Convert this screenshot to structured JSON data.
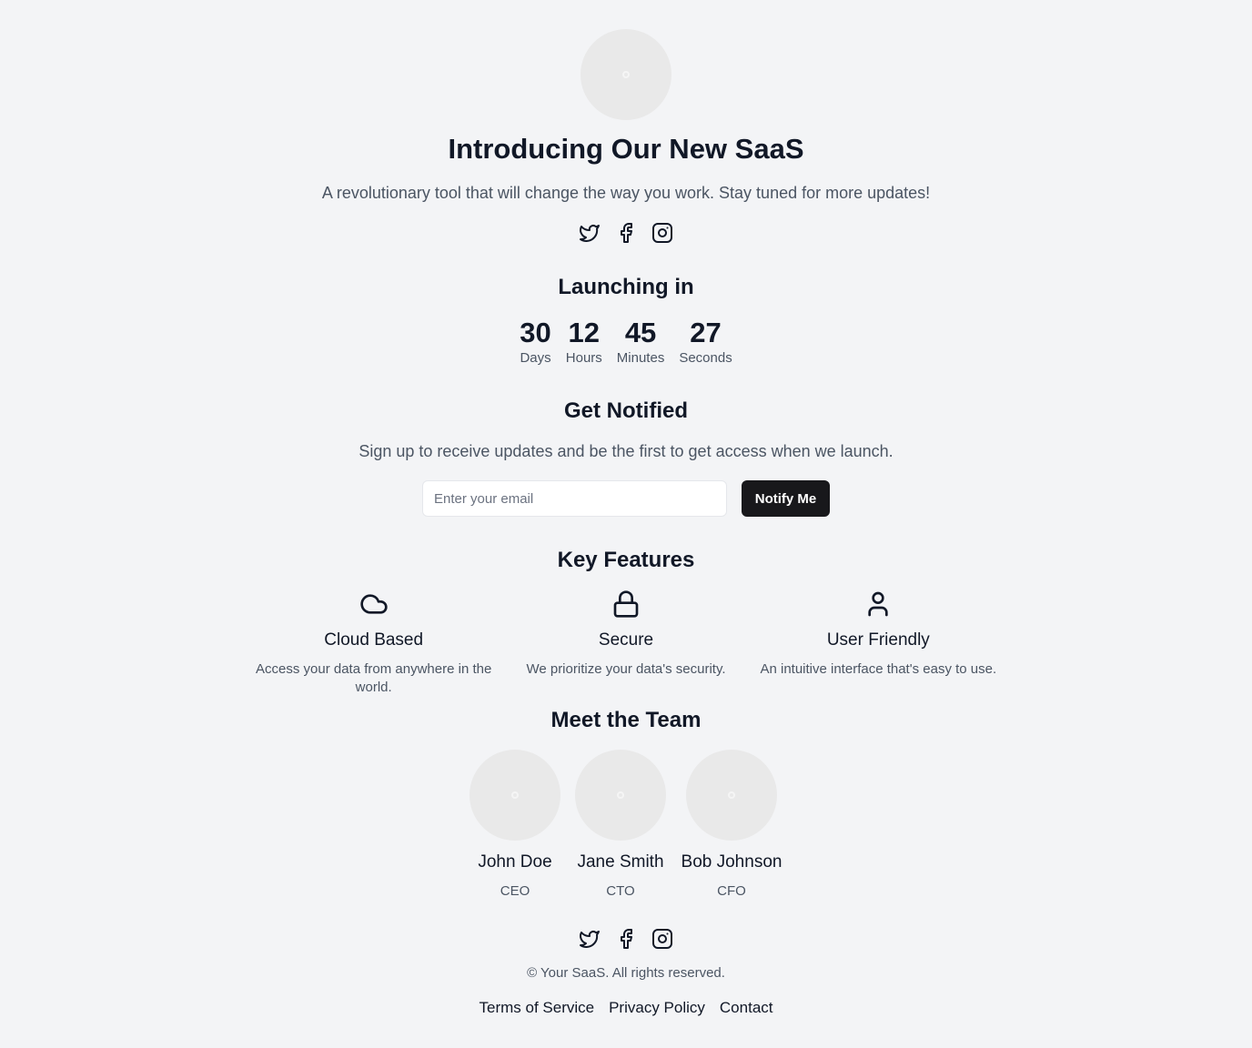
{
  "hero": {
    "title": "Introducing Our New SaaS",
    "subtitle": "A revolutionary tool that will change the way you work. Stay tuned for more updates!",
    "social_icons": [
      "twitter-icon",
      "facebook-icon",
      "instagram-icon"
    ]
  },
  "countdown": {
    "heading": "Launching in",
    "units": [
      {
        "value": "30",
        "label": "Days"
      },
      {
        "value": "12",
        "label": "Hours"
      },
      {
        "value": "45",
        "label": "Minutes"
      },
      {
        "value": "27",
        "label": "Seconds"
      }
    ]
  },
  "notify": {
    "heading": "Get Notified",
    "text": "Sign up to receive updates and be the first to get access when we launch.",
    "email_placeholder": "Enter your email",
    "email_value": "",
    "button_label": "Notify Me"
  },
  "features": {
    "heading": "Key Features",
    "items": [
      {
        "icon": "cloud-icon",
        "title": "Cloud Based",
        "desc": "Access your data from anywhere in the world."
      },
      {
        "icon": "lock-icon",
        "title": "Secure",
        "desc": "We prioritize your data's security."
      },
      {
        "icon": "user-icon",
        "title": "User Friendly",
        "desc": "An intuitive interface that's easy to use."
      }
    ]
  },
  "team": {
    "heading": "Meet the Team",
    "members": [
      {
        "name": "John Doe",
        "role": "CEO"
      },
      {
        "name": "Jane Smith",
        "role": "CTO"
      },
      {
        "name": "Bob Johnson",
        "role": "CFO"
      }
    ]
  },
  "footer": {
    "copyright": "© Your SaaS. All rights reserved.",
    "links": [
      "Terms of Service",
      "Privacy Policy",
      "Contact"
    ]
  },
  "colors": {
    "background": "#f3f4f6",
    "text": "#111827",
    "muted": "#4b5563",
    "button": "#18181b",
    "placeholder_avatar": "#e9e9e9"
  }
}
